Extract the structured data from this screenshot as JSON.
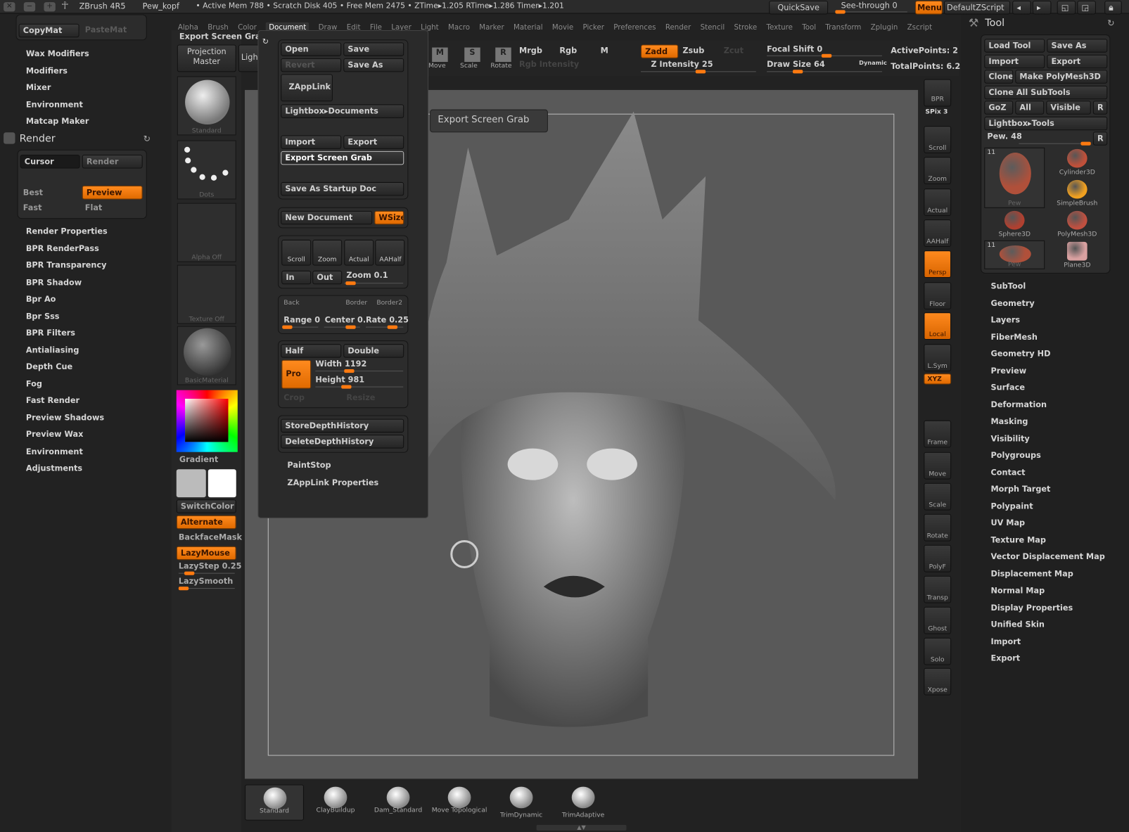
{
  "titlebar": {
    "app": "ZBrush 4R5",
    "doc": "Pew_kopf",
    "stats": "• Active Mem 788 • Scratch Disk 405 • Free Mem 2475 • ZTime▸1.205 RTime▸1.286 Timer▸1.201",
    "quicksave": "QuickSave",
    "see_through": "See-through  0",
    "see_through_value": 0,
    "menus": "Menus",
    "script": "DefaultZScript"
  },
  "menubar": [
    "Alpha",
    "Brush",
    "Color",
    "Document",
    "Draw",
    "Edit",
    "File",
    "Layer",
    "Light",
    "Macro",
    "Marker",
    "Material",
    "Movie",
    "Picker",
    "Preferences",
    "Render",
    "Stencil",
    "Stroke",
    "Texture",
    "Tool",
    "Transform",
    "Zplugin",
    "Zscript"
  ],
  "menubar_active": "Document",
  "left_panel": {
    "copymat": "CopyMat",
    "pastemat": "PasteMat",
    "top_items": [
      "Wax Modifiers",
      "Modifiers",
      "Mixer",
      "Environment",
      "Matcap Maker"
    ],
    "render": {
      "title": "Render",
      "cursor": "Cursor",
      "render": "Render",
      "best": "Best",
      "preview": "Preview",
      "fast": "Fast",
      "flat": "Flat"
    },
    "items": [
      "Render Properties",
      "BPR RenderPass",
      "BPR Transparency",
      "BPR Shadow",
      "Bpr Ao",
      "Bpr Sss",
      "BPR Filters",
      "Antialiasing",
      "Depth Cue",
      "Fog",
      "Fast Render",
      "Preview Shadows",
      "Preview Wax",
      "Environment",
      "Adjustments"
    ]
  },
  "left_shelf": {
    "heading": "Export Screen Grab",
    "projection_master": "Projection Master",
    "lightbox": "LightBox",
    "thumbs": [
      "Standard",
      "Dots",
      "Alpha Off",
      "Texture Off",
      "BasicMaterial"
    ],
    "gradient": "Gradient",
    "switchcolor": "SwitchColor",
    "alternate": "Alternate",
    "backfacemask": "BackfaceMask",
    "lazymouse": "LazyMouse",
    "lazystep": "LazyStep 0.25",
    "lazystep_value": 0.25,
    "lazysmooth": "LazySmooth"
  },
  "document_menu": {
    "open": "Open",
    "save": "Save",
    "revert": "Revert",
    "save_as": "Save As",
    "zapplink": "ZAppLink",
    "lightbox_docs": "Lightbox▸Documents",
    "import": "Import",
    "export": "Export",
    "export_screen_grab": "Export Screen Grab",
    "save_startup": "Save As Startup Doc",
    "new_document": "New Document",
    "wsize": "WSize",
    "scroll": "Scroll",
    "zoom": "Zoom",
    "actual": "Actual",
    "aahalf": "AAHalf",
    "in": "In",
    "out": "Out",
    "zoom_slider": "Zoom 0.1",
    "back": "Back",
    "border": "Border",
    "border2": "Border2",
    "range": "Range 0",
    "center": "Center 0.",
    "rate": "Rate 0.25",
    "half": "Half",
    "double": "Double",
    "pro": "Pro",
    "width": "Width 1192",
    "height": "Height 981",
    "crop": "Crop",
    "resize": "Resize",
    "store_depth": "StoreDepthHistory",
    "delete_depth": "DeleteDepthHistory",
    "paintstop": "PaintStop",
    "zapplink_props": "ZAppLink Properties"
  },
  "tooltip": "Export Screen Grab",
  "toolbar": {
    "move": "Move",
    "scale": "Scale",
    "rotate": "Rotate",
    "mrgb": "Mrgb",
    "rgb": "Rgb",
    "m": "M",
    "rgb_intensity": "Rgb Intensity",
    "zadd": "Zadd",
    "zsub": "Zsub",
    "zcut": "Zcut",
    "z_intensity": "Z Intensity 25",
    "focal_shift": "Focal Shift 0",
    "draw_size": "Draw Size 64",
    "dynamic": "Dynamic",
    "active_points": "ActivePoints: 2",
    "total_points": "TotalPoints: 6.2"
  },
  "right_shelf": [
    {
      "l": "BPR"
    },
    {
      "l": "Scroll"
    },
    {
      "l": "Zoom"
    },
    {
      "l": "Actual"
    },
    {
      "l": "AAHalf"
    },
    {
      "l": "Persp",
      "on": true
    },
    {
      "l": "Floor"
    },
    {
      "l": "Local",
      "on": true
    },
    {
      "l": "L.Sym"
    },
    {
      "l": "Frame"
    },
    {
      "l": "Move"
    },
    {
      "l": "Scale"
    },
    {
      "l": "Rotate"
    },
    {
      "l": "PolyF"
    },
    {
      "l": "Transp"
    },
    {
      "l": "Ghost"
    },
    {
      "l": "Solo"
    },
    {
      "l": "Xpose"
    }
  ],
  "spix": "SPix 3",
  "xyz": "XYZ",
  "tool_panel": {
    "title": "Tool",
    "load_tool": "Load Tool",
    "save_as": "Save As",
    "import": "Import",
    "export": "Export",
    "clone": "Clone",
    "make_polymesh": "Make PolyMesh3D",
    "clone_all": "Clone All SubTools",
    "goz": "GoZ",
    "all": "All",
    "visible": "Visible",
    "r": "R",
    "lightbox_tools": "Lightbox▸Tools",
    "pew": "Pew. 48",
    "tools": [
      "Pew",
      "Cylinder3D",
      "SimpleBrush",
      "Sphere3D",
      "PolyMesh3D",
      "Pew",
      "Plane3D"
    ],
    "count": "11",
    "items": [
      "SubTool",
      "Geometry",
      "Layers",
      "FiberMesh",
      "Geometry HD",
      "Preview",
      "Surface",
      "Deformation",
      "Masking",
      "Visibility",
      "Polygroups",
      "Contact",
      "Morph Target",
      "Polypaint",
      "UV Map",
      "Texture Map",
      "Vector Displacement Map",
      "Displacement Map",
      "Normal Map",
      "Display Properties",
      "Unified Skin",
      "Import",
      "Export"
    ]
  },
  "brush_shelf": [
    "Standard",
    "ClayBuildup",
    "Dam_Standard",
    "Move Topological",
    "TrimDynamic",
    "TrimAdaptive"
  ],
  "colors": {
    "accent": "#ff7a10",
    "canvas": "#5a5a5a",
    "panel": "#222222"
  }
}
